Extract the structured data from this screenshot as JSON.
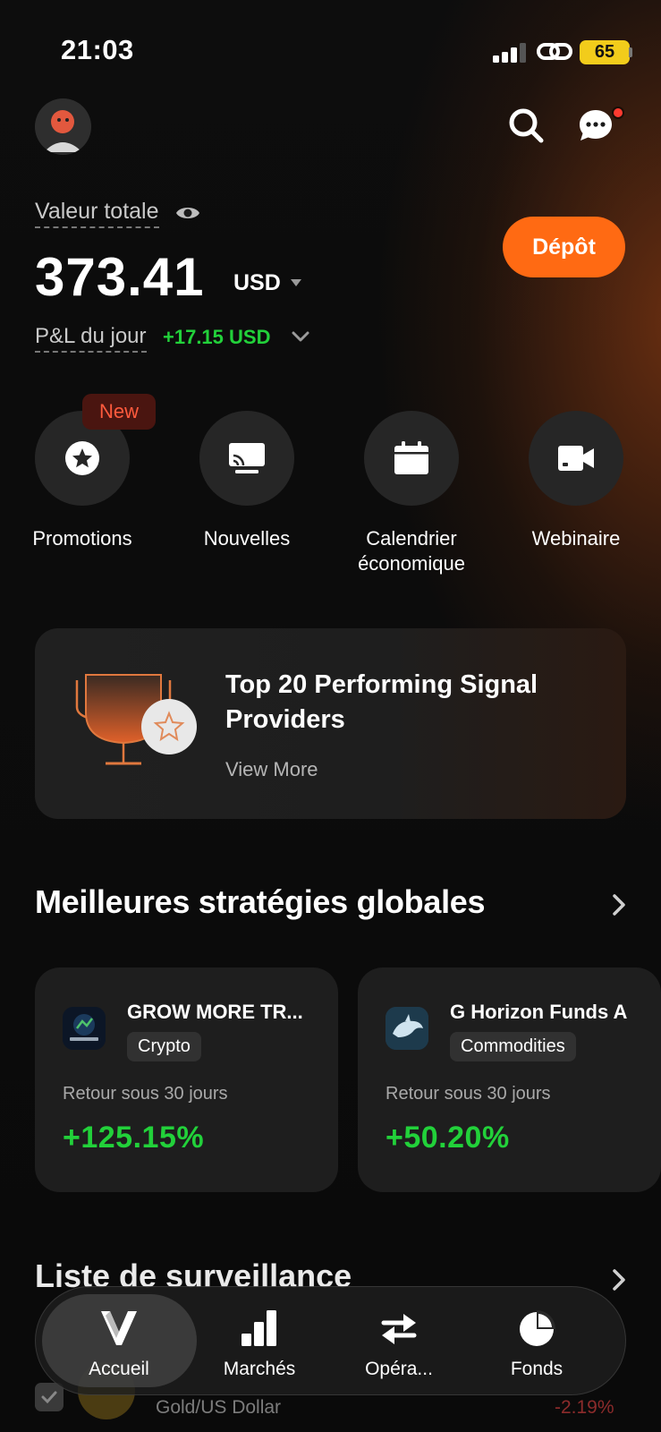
{
  "status_bar": {
    "time": "21:03",
    "battery": "65"
  },
  "header": {
    "search_icon": "search-icon",
    "chat_icon": "chat-bubble-icon"
  },
  "portfolio": {
    "total_label": "Valeur totale",
    "amount": "373.41",
    "currency": "USD",
    "deposit_label": "Dépôt",
    "pnl_label": "P&L du jour",
    "pnl_value": "+17.15 USD"
  },
  "quick_actions": [
    {
      "label": "Promotions",
      "icon": "star-badge-icon",
      "badge": "New"
    },
    {
      "label": "Nouvelles",
      "icon": "news-icon"
    },
    {
      "label": "Calendrier économique",
      "icon": "calendar-icon"
    },
    {
      "label": "Webinaire",
      "icon": "video-camera-icon"
    }
  ],
  "promo": {
    "title": "Top 20 Performing Signal Providers",
    "link": "View More"
  },
  "strategies": {
    "title": "Meilleures stratégies globales",
    "items": [
      {
        "name": "GROW MORE TR...",
        "tag": "Crypto",
        "return_label": "Retour sous 30 jours",
        "return_value": "+125.15%"
      },
      {
        "name": "G Horizon Funds A",
        "tag": "Commodities",
        "return_label": "Retour sous 30 jours",
        "return_value": "+50.20%"
      }
    ]
  },
  "watchlist": {
    "title": "Liste de surveillance",
    "first_row_subtitle": "Gold/US Dollar",
    "first_row_change": "-2.19%"
  },
  "tabbar": [
    {
      "label": "Accueil",
      "icon": "home-logo-icon",
      "active": true
    },
    {
      "label": "Marchés",
      "icon": "bar-chart-icon"
    },
    {
      "label": "Opéra...",
      "icon": "swap-arrows-icon"
    },
    {
      "label": "Fonds",
      "icon": "pie-chart-icon"
    }
  ],
  "colors": {
    "accent": "#ff6a13",
    "positive": "#22d13a",
    "badge_text": "#ff5a3d",
    "battery": "#f2cc1b"
  }
}
